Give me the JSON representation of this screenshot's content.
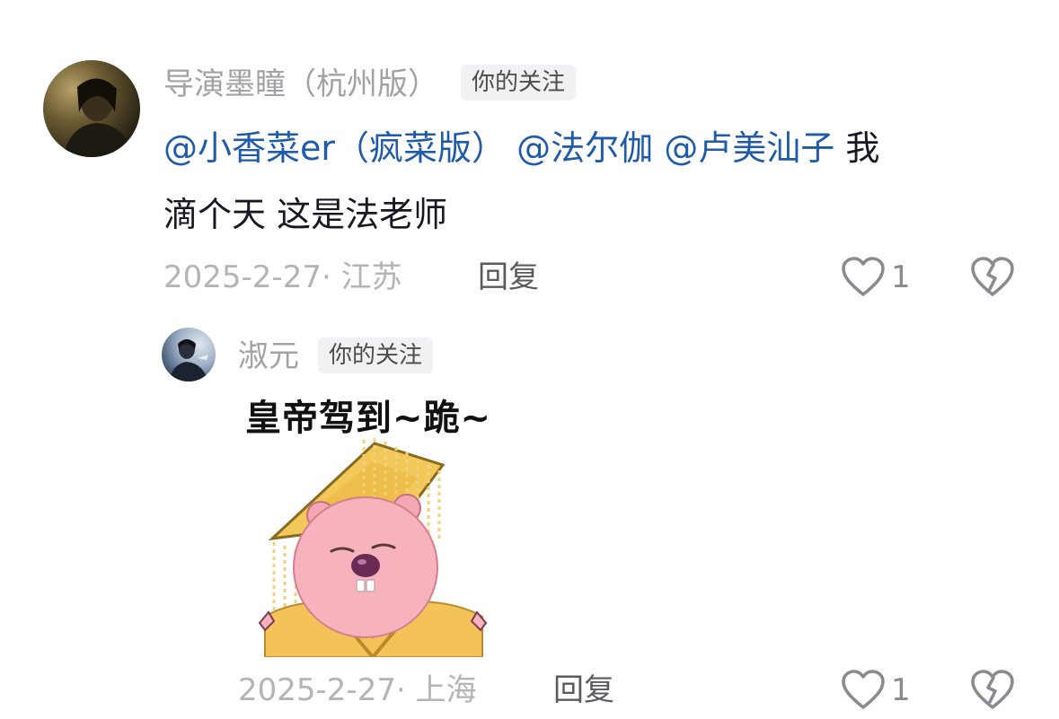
{
  "comment": {
    "username": "导演墨瞳（杭州版）",
    "badge": "你的关注",
    "mention_1": "@小香菜er（疯菜版）",
    "mention_2": "@法尔伽",
    "mention_3": "@卢美汕子",
    "text_tail_1": "我",
    "text_tail_2": "滴个天 这是法老师",
    "date_location": "2025-2-27· 江苏",
    "reply_label": "回复",
    "like_count": "1"
  },
  "reply": {
    "username": "淑元",
    "badge": "你的关注",
    "sticker_text": "皇帝驾到~跪~",
    "date_location": "2025-2-27· 上海",
    "reply_label": "回复",
    "like_count": "1"
  },
  "icons": {
    "like": "heart-outline-icon",
    "dislike": "broken-heart-icon"
  },
  "colors": {
    "mention": "#1f5ba8",
    "meta": "#b3b3b8",
    "badge_bg": "#f1f1f3"
  }
}
